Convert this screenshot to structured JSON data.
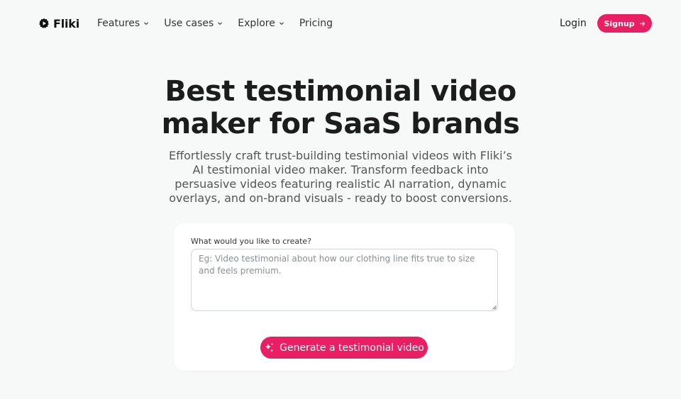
{
  "brand": {
    "name": "Fliki",
    "accent": "#e91e63"
  },
  "nav": {
    "items": [
      {
        "label": "Features",
        "dropdown": true
      },
      {
        "label": "Use cases",
        "dropdown": true
      },
      {
        "label": "Explore",
        "dropdown": true
      },
      {
        "label": "Pricing",
        "dropdown": false
      }
    ],
    "login_label": "Login",
    "signup_label": "Signup"
  },
  "hero": {
    "title_line1": "Best testimonial video",
    "title_line2": "maker for SaaS brands",
    "subtitle": "Effortlessly craft trust-building testimonial videos with Fliki’s AI testimonial video maker. Transform feedback into persuasive videos featuring realistic AI narration, dynamic overlays, and on-brand visuals - ready to boost conversions."
  },
  "create_card": {
    "label": "What would you like to create?",
    "placeholder": "Eg: Video testimonial about how our clothing line fits true to size and feels premium.",
    "value": "",
    "button_label": "Generate a testimonial video",
    "button_icon": "sparkle-icon"
  }
}
